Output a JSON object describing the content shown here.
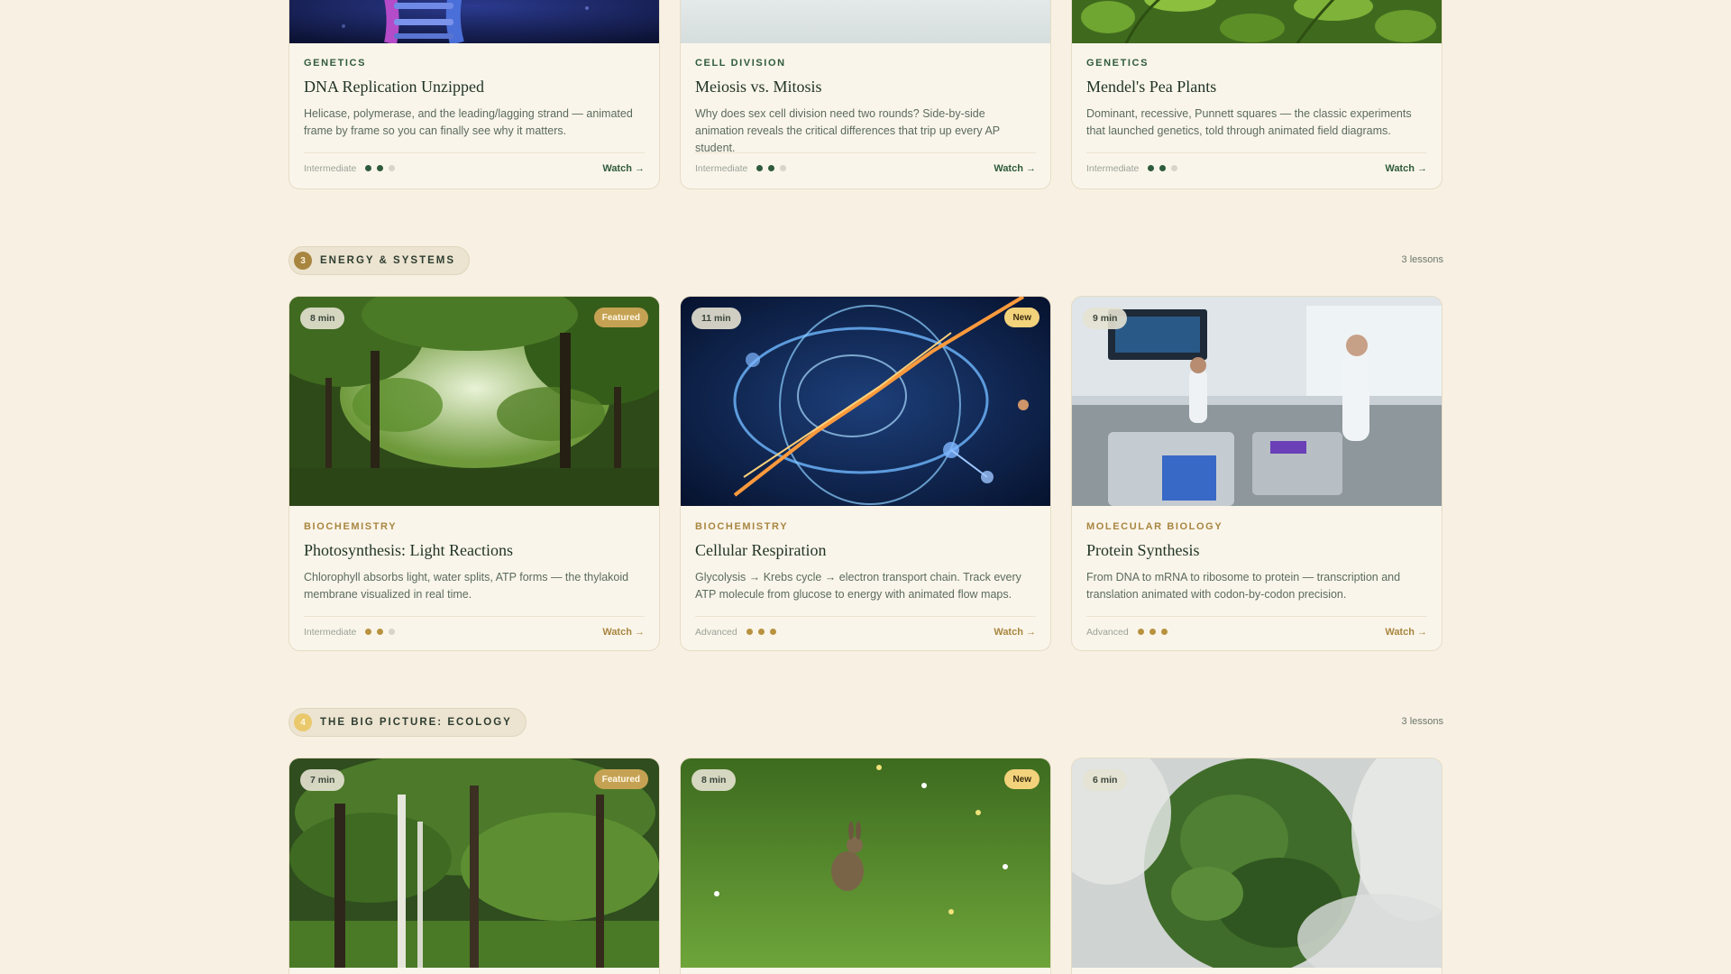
{
  "sections": [
    {
      "number": "",
      "title": "",
      "count": "",
      "lessons": [
        {
          "category": "Genetics",
          "title": "DNA Replication Unzipped",
          "description": "Helicase, polymerase, and the leading/lagging strand — animated frame by frame so you can finally see why it matters.",
          "level": "Intermediate",
          "level_dots": 2,
          "watch": "Watch →",
          "image": "dna-helix-image"
        },
        {
          "category": "Cell Division",
          "title": "Meiosis vs. Mitosis",
          "description": "Why does sex cell division need two rounds? Side-by-side animation reveals the critical differences that trip up every AP student.",
          "level": "Intermediate",
          "level_dots": 2,
          "watch": "Watch →",
          "image": "cell-division-image"
        },
        {
          "category": "Genetics",
          "title": "Mendel's Pea Plants",
          "description": "Dominant, recessive, Punnett squares — the classic experiments that launched genetics, told through animated field diagrams.",
          "level": "Intermediate",
          "level_dots": 2,
          "watch": "Watch →",
          "image": "pea-plants-image"
        }
      ]
    },
    {
      "number": "3",
      "title": "ENERGY & SYSTEMS",
      "count": "3 lessons",
      "lessons": [
        {
          "category": "Biochemistry",
          "title": "Photosynthesis: Light Reactions",
          "description": "Chlorophyll absorbs light, water splits, ATP forms — the thylakoid membrane visualized in real time.",
          "level": "Intermediate",
          "level_dots": 2,
          "watch": "Watch →",
          "duration": "8 min",
          "badge": "Featured",
          "image": "forest-canopy-image"
        },
        {
          "category": "Biochemistry",
          "title": "Cellular Respiration",
          "description": "Glycolysis → Krebs cycle → electron transport chain. Track every ATP molecule from glucose to energy with animated flow maps.",
          "level": "Advanced",
          "level_dots": 3,
          "watch": "Watch →",
          "duration": "11 min",
          "badge": "New",
          "image": "energy-network-image"
        },
        {
          "category": "Molecular Biology",
          "title": "Protein Synthesis",
          "description": "From DNA to mRNA to ribosome to protein — transcription and translation animated with codon-by-codon precision.",
          "level": "Advanced",
          "level_dots": 3,
          "watch": "Watch →",
          "duration": "9 min",
          "badge": "",
          "image": "laboratory-image"
        }
      ]
    },
    {
      "number": "4",
      "title": "THE BIG PICTURE: ECOLOGY",
      "count": "3 lessons",
      "lessons": [
        {
          "duration": "7 min",
          "badge": "Featured",
          "image": "birch-forest-image"
        },
        {
          "duration": "8 min",
          "badge": "New",
          "image": "rabbit-meadow-image"
        },
        {
          "duration": "6 min",
          "badge": "",
          "image": "aerial-forest-image"
        }
      ]
    }
  ],
  "colors": {
    "background": "#f8f1e3",
    "green_accent": "#2e5b3c",
    "gold_accent": "#a88640"
  }
}
